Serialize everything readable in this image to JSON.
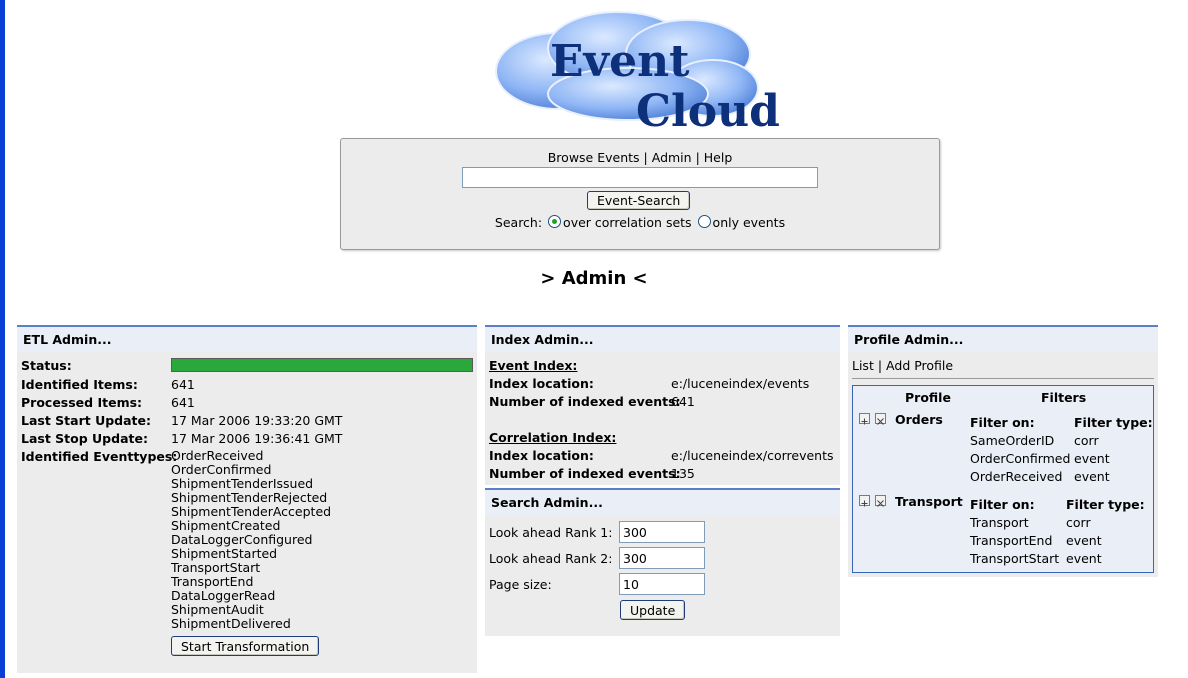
{
  "logo": {
    "line1": "Event",
    "line2": "Cloud"
  },
  "topnav": {
    "browse": "Browse Events",
    "admin": "Admin",
    "help": "Help",
    "sep": "|"
  },
  "search": {
    "value": "",
    "button": "Event-Search",
    "label": "Search:",
    "opt1": "over correlation sets",
    "opt2": "only events",
    "selected": "over correlation sets"
  },
  "page_heading": "> Admin <",
  "etl": {
    "title": "ETL Admin...",
    "status_label": "Status:",
    "progress_percent": 100,
    "identified_label": "Identified Items:",
    "identified_value": "641",
    "processed_label": "Processed Items:",
    "processed_value": "641",
    "last_start_label": "Last Start Update:",
    "last_start_value": "17 Mar 2006 19:33:20 GMT",
    "last_stop_label": "Last Stop Update:",
    "last_stop_value": "17 Mar 2006 19:36:41 GMT",
    "eventtypes_label": "Identified Eventtypes:",
    "eventtypes": [
      "OrderReceived",
      "OrderConfirmed",
      "ShipmentTenderIssued",
      "ShipmentTenderRejected",
      "ShipmentTenderAccepted",
      "ShipmentCreated",
      "DataLoggerConfigured",
      "ShipmentStarted",
      "TransportStart",
      "TransportEnd",
      "DataLoggerRead",
      "ShipmentAudit",
      "ShipmentDelivered"
    ],
    "button": "Start Transformation"
  },
  "index": {
    "title": "Index Admin...",
    "event_index": "Event Index:",
    "loc_label": "Index location:",
    "event_loc": "e:/luceneindex/events",
    "count_label": "Number of indexed events:",
    "event_count": "641",
    "corr_index": "Correlation Index:",
    "corr_loc": "e:/luceneindex/correvents",
    "corr_count": "135"
  },
  "search_admin": {
    "title": "Search Admin...",
    "rank1_label": "Look ahead Rank 1:",
    "rank1_value": "300",
    "rank2_label": "Look ahead Rank 2:",
    "rank2_value": "300",
    "page_label": "Page size:",
    "page_value": "10",
    "button": "Update"
  },
  "profile": {
    "title": "Profile Admin...",
    "list": "List",
    "sep": "|",
    "add": "Add Profile",
    "col_profile": "Profile",
    "col_filters": "Filters",
    "filter_on": "Filter on:",
    "filter_type": "Filter type:",
    "profiles": [
      {
        "name": "Orders",
        "filters": [
          [
            "SameOrderID",
            "corr"
          ],
          [
            "OrderConfirmed",
            "event"
          ],
          [
            "OrderReceived",
            "event"
          ]
        ]
      },
      {
        "name": "Transport",
        "filters": [
          [
            "Transport",
            "corr"
          ],
          [
            "TransportEnd",
            "event"
          ],
          [
            "TransportStart",
            "event"
          ]
        ]
      }
    ]
  }
}
